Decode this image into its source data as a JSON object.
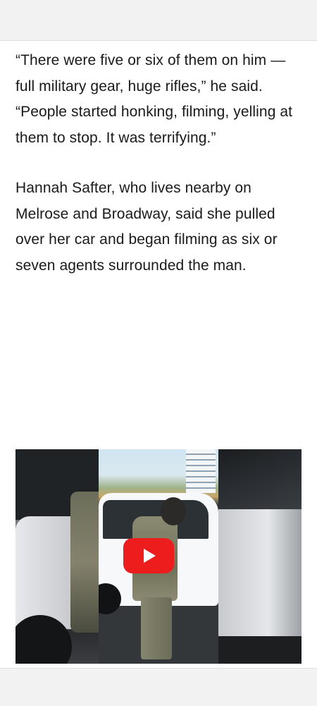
{
  "article": {
    "paragraphs": [
      "“There were five or six of them on him — full military gear, huge rifles,” he said. “People started honking, filming, yelling at them to stop. It was terrifying.”",
      "Hannah Safter, who lives nearby on Melrose and Broadway, said she pulled over her car and began filming as six or seven agents surrounded the man."
    ]
  },
  "video": {
    "play_icon": "youtube-play-icon",
    "play_color": "#ee1d1d"
  },
  "colors": {
    "bar_background": "#f2f2f2",
    "text": "#1a1a1a"
  }
}
